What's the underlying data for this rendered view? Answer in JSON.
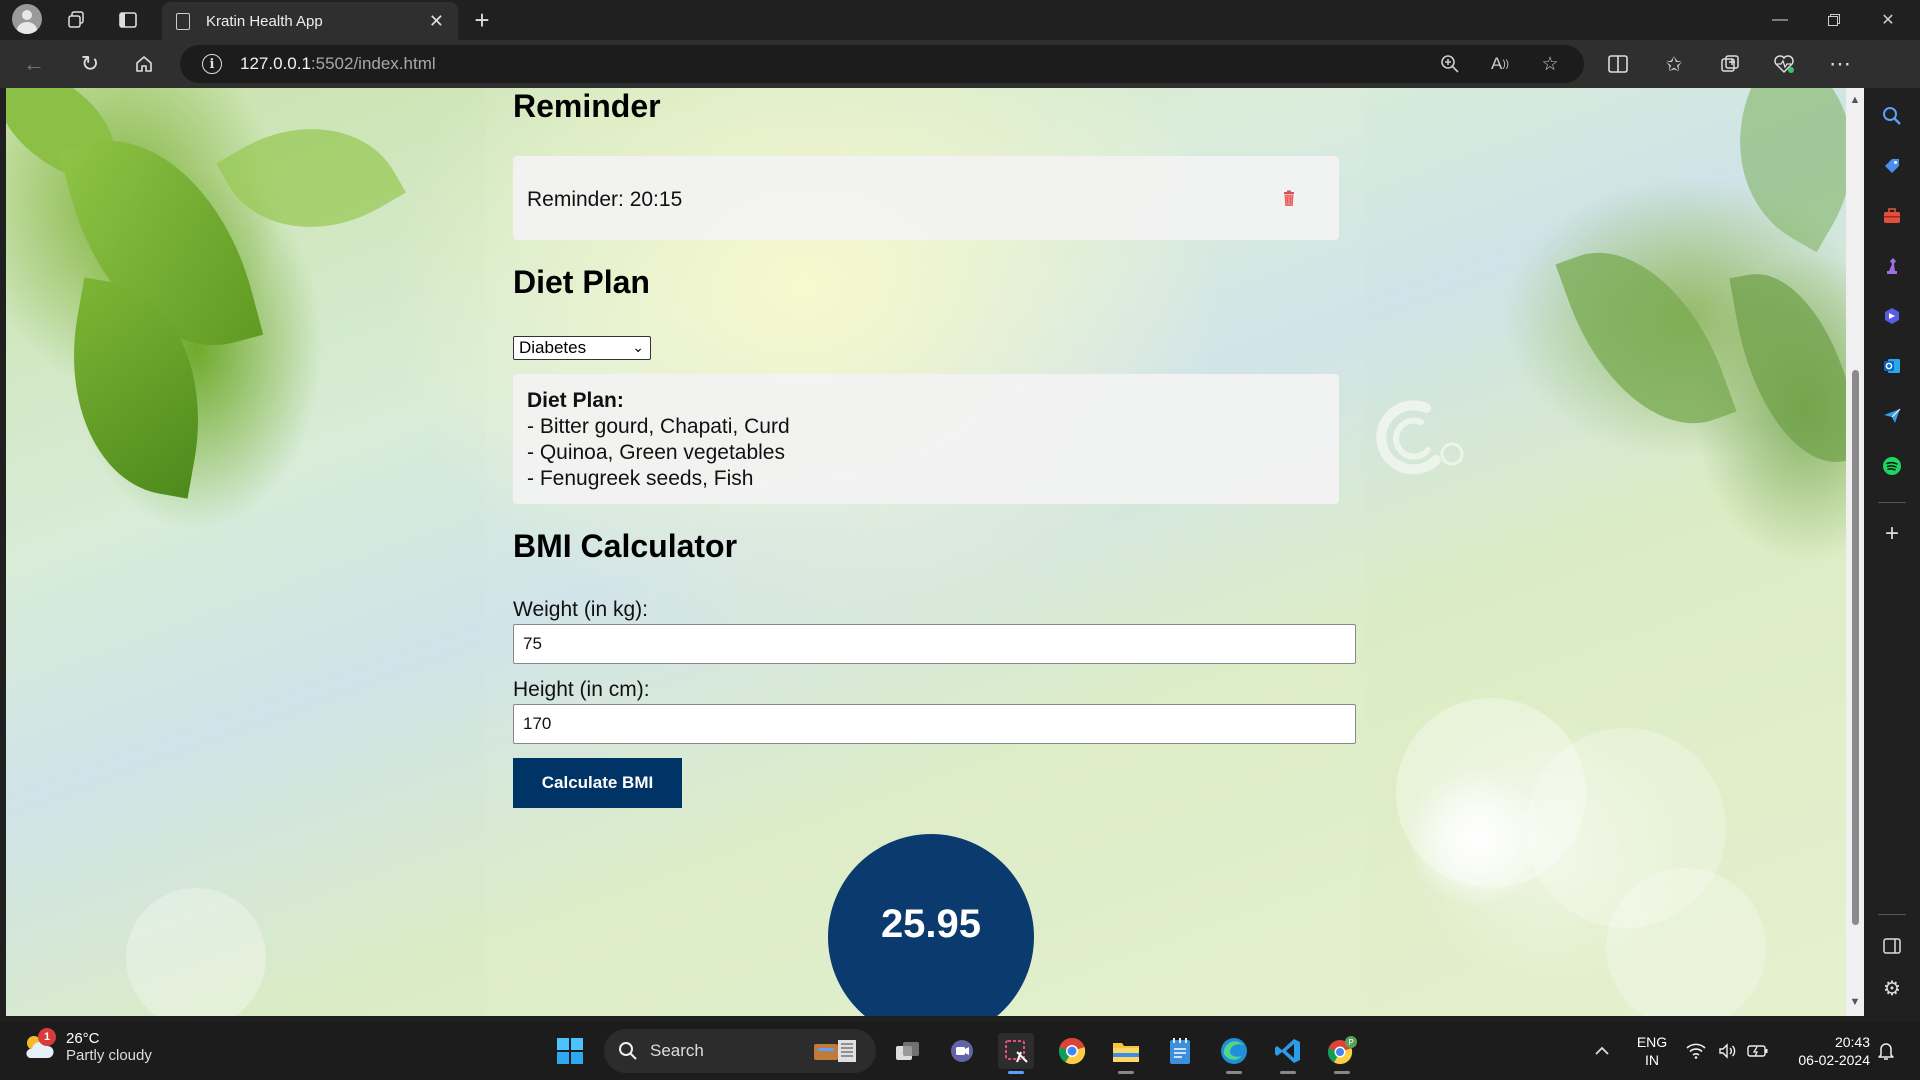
{
  "browser": {
    "tab_title": "Kratin Health App",
    "url_host": "127.0.0.1",
    "url_path": ":5502/index.html"
  },
  "page": {
    "reminder": {
      "title": "Reminder",
      "item_text": "Reminder: 20:15"
    },
    "diet": {
      "title": "Diet Plan",
      "selected_condition": "Diabetes",
      "plan_heading": "Diet Plan:",
      "lines": [
        "- Bitter gourd, Chapati, Curd",
        "- Quinoa, Green vegetables",
        "- Fenugreek seeds, Fish"
      ]
    },
    "bmi": {
      "title": "BMI Calculator",
      "weight_label": "Weight (in kg):",
      "weight_value": "75",
      "height_label": "Height (in cm):",
      "height_value": "170",
      "button_label": "Calculate BMI",
      "result": "25.95"
    }
  },
  "taskbar": {
    "weather_temp": "26°C",
    "weather_desc": "Partly cloudy",
    "weather_badge": "1",
    "search_label": "Search",
    "lang_top": "ENG",
    "lang_bottom": "IN",
    "time": "20:43",
    "date": "06-02-2024"
  },
  "colors": {
    "bmi_button": "#003366",
    "bmi_circle": "#0b3a6e",
    "trash": "#e05050"
  }
}
